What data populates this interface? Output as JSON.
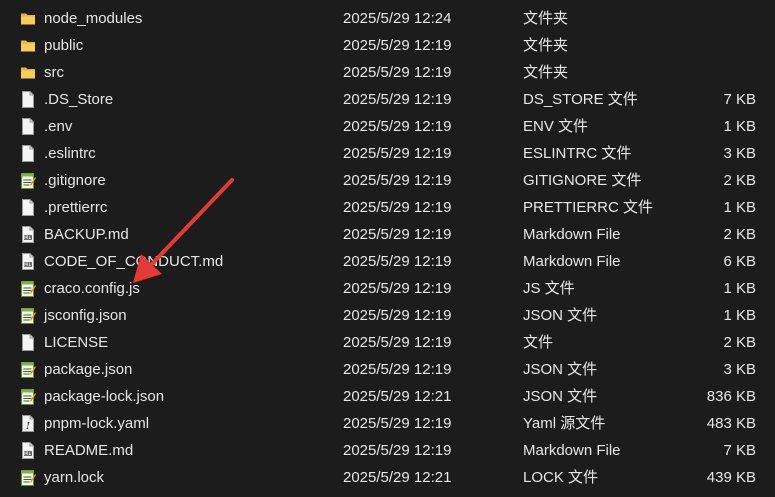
{
  "files": [
    {
      "name": "node_modules",
      "date": "2025/5/29 12:24",
      "type": "文件夹",
      "size": "",
      "icon": "folder-icon"
    },
    {
      "name": "public",
      "date": "2025/5/29 12:19",
      "type": "文件夹",
      "size": "",
      "icon": "folder-icon"
    },
    {
      "name": "src",
      "date": "2025/5/29 12:19",
      "type": "文件夹",
      "size": "",
      "icon": "folder-icon"
    },
    {
      "name": ".DS_Store",
      "date": "2025/5/29 12:19",
      "type": "DS_STORE 文件",
      "size": "7 KB",
      "icon": "file-icon"
    },
    {
      "name": ".env",
      "date": "2025/5/29 12:19",
      "type": "ENV 文件",
      "size": "1 KB",
      "icon": "file-icon"
    },
    {
      "name": ".eslintrc",
      "date": "2025/5/29 12:19",
      "type": "ESLINTRC 文件",
      "size": "3 KB",
      "icon": "file-icon"
    },
    {
      "name": ".gitignore",
      "date": "2025/5/29 12:19",
      "type": "GITIGNORE 文件",
      "size": "2 KB",
      "icon": "notepad-icon"
    },
    {
      "name": ".prettierrc",
      "date": "2025/5/29 12:19",
      "type": "PRETTIERRC 文件",
      "size": "1 KB",
      "icon": "file-icon"
    },
    {
      "name": "BACKUP.md",
      "date": "2025/5/29 12:19",
      "type": "Markdown File",
      "size": "2 KB",
      "icon": "markdown-icon"
    },
    {
      "name": "CODE_OF_CONDUCT.md",
      "date": "2025/5/29 12:19",
      "type": "Markdown File",
      "size": "6 KB",
      "icon": "markdown-icon"
    },
    {
      "name": "craco.config.js",
      "date": "2025/5/29 12:19",
      "type": "JS 文件",
      "size": "1 KB",
      "icon": "notepad-icon"
    },
    {
      "name": "jsconfig.json",
      "date": "2025/5/29 12:19",
      "type": "JSON 文件",
      "size": "1 KB",
      "icon": "notepad-icon"
    },
    {
      "name": "LICENSE",
      "date": "2025/5/29 12:19",
      "type": "文件",
      "size": "2 KB",
      "icon": "file-icon"
    },
    {
      "name": "package.json",
      "date": "2025/5/29 12:19",
      "type": "JSON 文件",
      "size": "3 KB",
      "icon": "notepad-icon"
    },
    {
      "name": "package-lock.json",
      "date": "2025/5/29 12:21",
      "type": "JSON 文件",
      "size": "836 KB",
      "icon": "notepad-icon"
    },
    {
      "name": "pnpm-lock.yaml",
      "date": "2025/5/29 12:19",
      "type": "Yaml 源文件",
      "size": "483 KB",
      "icon": "yaml-icon"
    },
    {
      "name": "README.md",
      "date": "2025/5/29 12:19",
      "type": "Markdown File",
      "size": "7 KB",
      "icon": "markdown-icon"
    },
    {
      "name": "yarn.lock",
      "date": "2025/5/29 12:21",
      "type": "LOCK 文件",
      "size": "439 KB",
      "icon": "notepad-icon"
    }
  ],
  "colors": {
    "background": "#1c1c1c",
    "text": "#e6e6e6",
    "folder": "#f2c94c",
    "annotation_arrow": "#e53935"
  }
}
